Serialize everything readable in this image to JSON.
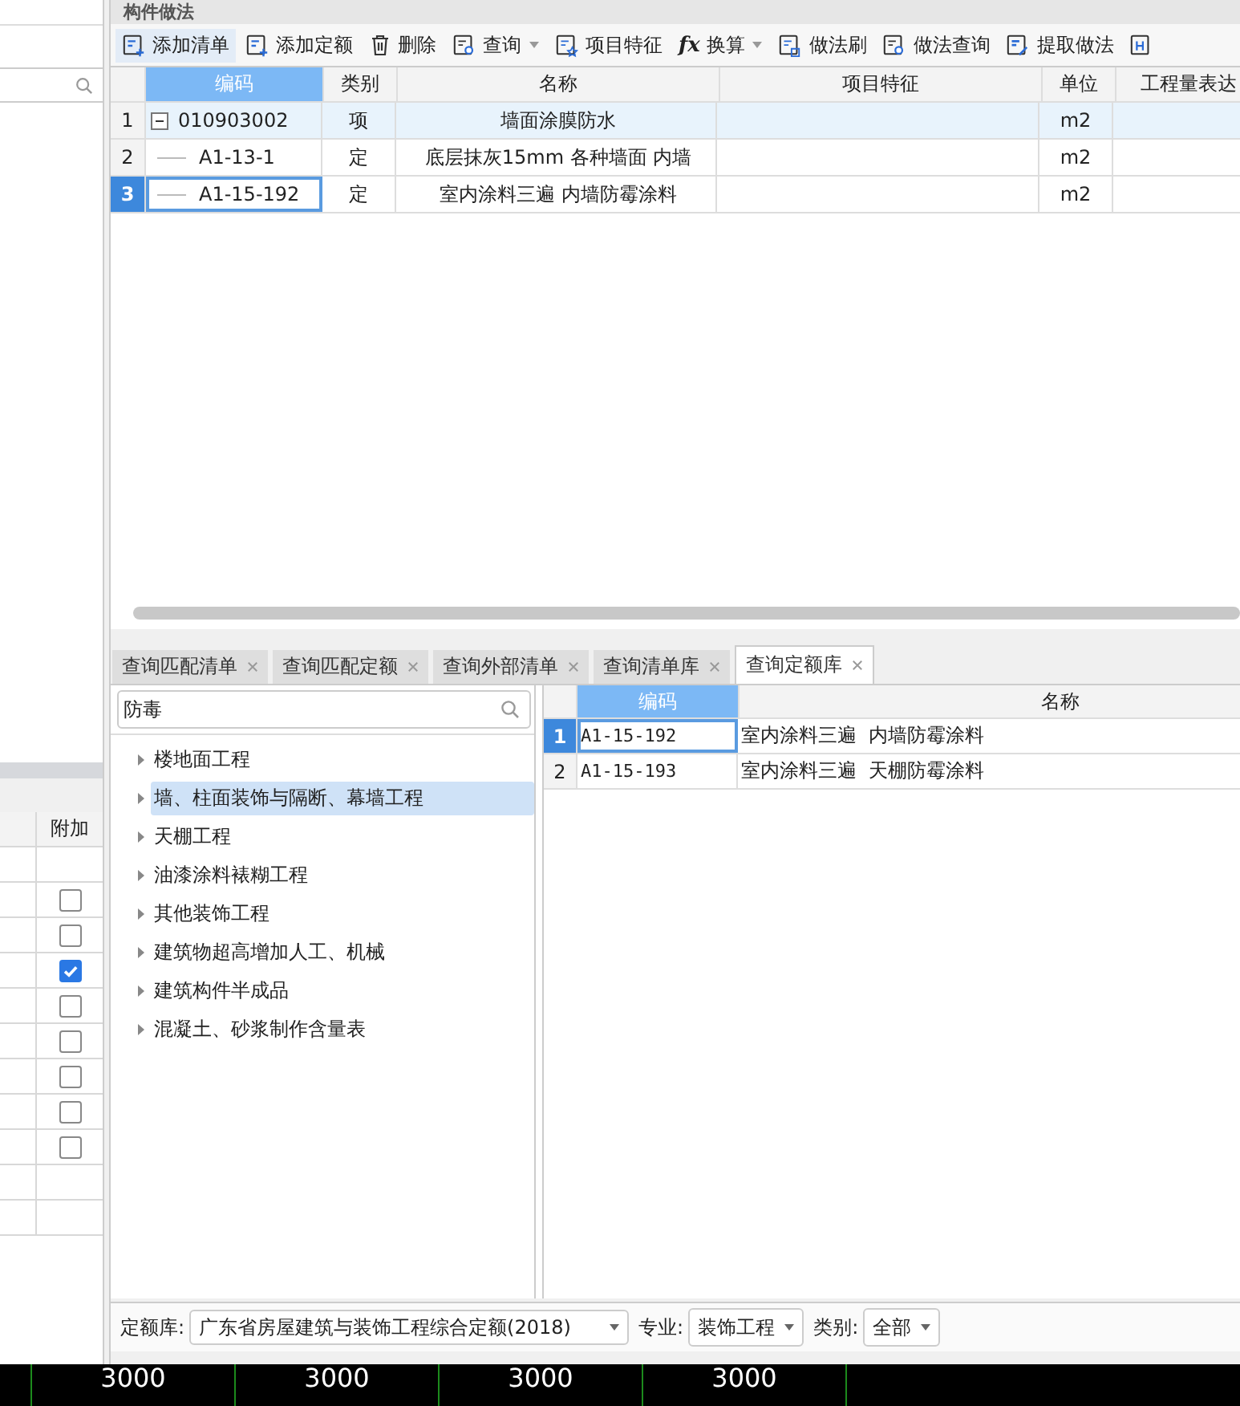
{
  "panel_title": "构件做法",
  "toolbar": [
    {
      "label": "添加清单",
      "selected": true,
      "dropdown": false
    },
    {
      "label": "添加定额",
      "selected": false,
      "dropdown": false
    },
    {
      "label": "删除",
      "selected": false,
      "dropdown": false
    },
    {
      "label": "查询",
      "selected": false,
      "dropdown": true
    },
    {
      "label": "项目特征",
      "selected": false,
      "dropdown": false
    },
    {
      "label": "换算",
      "symbol": "fx",
      "selected": false,
      "dropdown": true
    },
    {
      "label": "做法刷",
      "selected": false,
      "dropdown": false
    },
    {
      "label": "做法查询",
      "selected": false,
      "dropdown": false
    },
    {
      "label": "提取做法",
      "selected": false,
      "dropdown": false
    },
    {
      "selected": false,
      "dropdown": false
    }
  ],
  "table": {
    "columns": [
      "编码",
      "类别",
      "名称",
      "项目特征",
      "单位",
      "工程量表达"
    ],
    "rows": [
      {
        "index": "1",
        "code": "010903002",
        "type": "项",
        "name": "墙面涂膜防水",
        "unit": "m2",
        "kind": "parent",
        "expanded": true,
        "selected": false
      },
      {
        "index": "2",
        "code": "A1-13-1",
        "type": "定",
        "name": "底层抹灰15mm 各种墙面 内墙",
        "unit": "m2",
        "kind": "child",
        "selected": false
      },
      {
        "index": "3",
        "code": "A1-15-192",
        "type": "定",
        "name": "室内涂料三遍 内墙防霉涂料",
        "unit": "m2",
        "kind": "child",
        "selected": true
      }
    ]
  },
  "tabs": [
    {
      "label": "查询匹配清单",
      "selected": false
    },
    {
      "label": "查询匹配定额",
      "selected": false
    },
    {
      "label": "查询外部清单",
      "selected": false
    },
    {
      "label": "查询清单库",
      "selected": false
    },
    {
      "label": "查询定额库",
      "selected": true
    }
  ],
  "search": {
    "value": "防毒"
  },
  "tree": [
    {
      "label": "楼地面工程",
      "selected": false
    },
    {
      "label": "墙、柱面装饰与隔断、幕墙工程",
      "selected": true
    },
    {
      "label": "天棚工程",
      "selected": false
    },
    {
      "label": "油漆涂料裱糊工程",
      "selected": false
    },
    {
      "label": "其他装饰工程",
      "selected": false
    },
    {
      "label": "建筑物超高增加人工、机械",
      "selected": false
    },
    {
      "label": "建筑构件半成品",
      "selected": false
    },
    {
      "label": "混凝土、砂浆制作含量表",
      "selected": false
    }
  ],
  "results": {
    "columns": [
      "编码",
      "名称"
    ],
    "rows": [
      {
        "index": "1",
        "code": "A1-15-192",
        "name": "室内涂料三遍  内墙防霉涂料",
        "selected": true
      },
      {
        "index": "2",
        "code": "A1-15-193",
        "name": "室内涂料三遍  天棚防霉涂料",
        "selected": false
      }
    ]
  },
  "filters": [
    {
      "label": "定额库:",
      "value": "广东省房屋建筑与装饰工程综合定额(2018)"
    },
    {
      "label": "专业:",
      "value": "装饰工程"
    },
    {
      "label": "类别:",
      "value": "全部"
    }
  ],
  "left_table": {
    "column": "附加",
    "rows": [
      {
        "kind": "empty"
      },
      {
        "kind": "checkbox",
        "checked": false
      },
      {
        "kind": "checkbox",
        "checked": false
      },
      {
        "kind": "checkbox",
        "checked": true
      },
      {
        "kind": "checkbox",
        "checked": false
      },
      {
        "kind": "checkbox",
        "checked": false
      },
      {
        "kind": "checkbox",
        "checked": false
      },
      {
        "kind": "checkbox",
        "checked": false
      },
      {
        "kind": "checkbox",
        "checked": false
      },
      {
        "kind": "empty"
      },
      {
        "kind": "empty"
      }
    ]
  },
  "ruler": [
    "3000",
    "3000",
    "3000",
    "3000"
  ]
}
